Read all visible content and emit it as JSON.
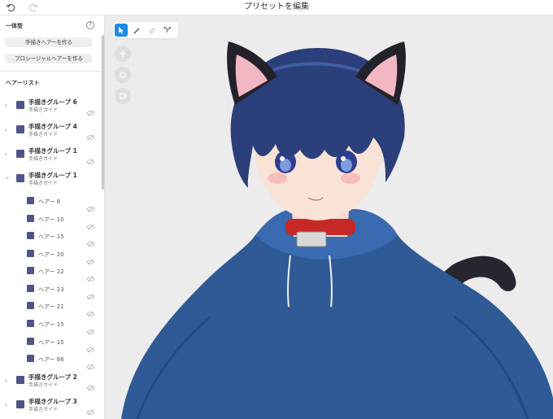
{
  "app": {
    "title": "プリセットを編集"
  },
  "toolbar_icons": {
    "undo": "undo-icon",
    "redo": "redo-icon"
  },
  "sidebar": {
    "section_title": "一体型",
    "create_handdrawn": "手描きヘアーを作る",
    "create_procedural": "プロシージャルヘアーを作る",
    "hair_list_title": "ヘアーリスト",
    "groups_top": [
      {
        "name": "手描きグループ 6",
        "sub": "手描きガイド"
      },
      {
        "name": "手描きグループ 4",
        "sub": "手描きガイド"
      },
      {
        "name": "手描きグループ 1",
        "sub": "手描きガイド"
      }
    ],
    "expanded_group": {
      "name": "手描きグループ 1",
      "sub": "手描きガイド"
    },
    "hairs": [
      "ヘアー 8",
      "ヘアー 10",
      "ヘアー 15",
      "ヘアー 20",
      "ヘアー 22",
      "ヘアー 23",
      "ヘアー 21",
      "ヘアー 15",
      "ヘアー 15",
      "ヘアー 66"
    ],
    "groups_bottom": [
      {
        "name": "手描きグループ 2",
        "sub": "手描きガイド"
      },
      {
        "name": "手描きグループ 3",
        "sub": "手描きガイド"
      }
    ]
  },
  "colors": {
    "accent": "#1e88e5",
    "swatch": "#4f5586",
    "hoodie": "#2f5a96",
    "hair": "#2b3f7a",
    "collar": "#c62828"
  }
}
